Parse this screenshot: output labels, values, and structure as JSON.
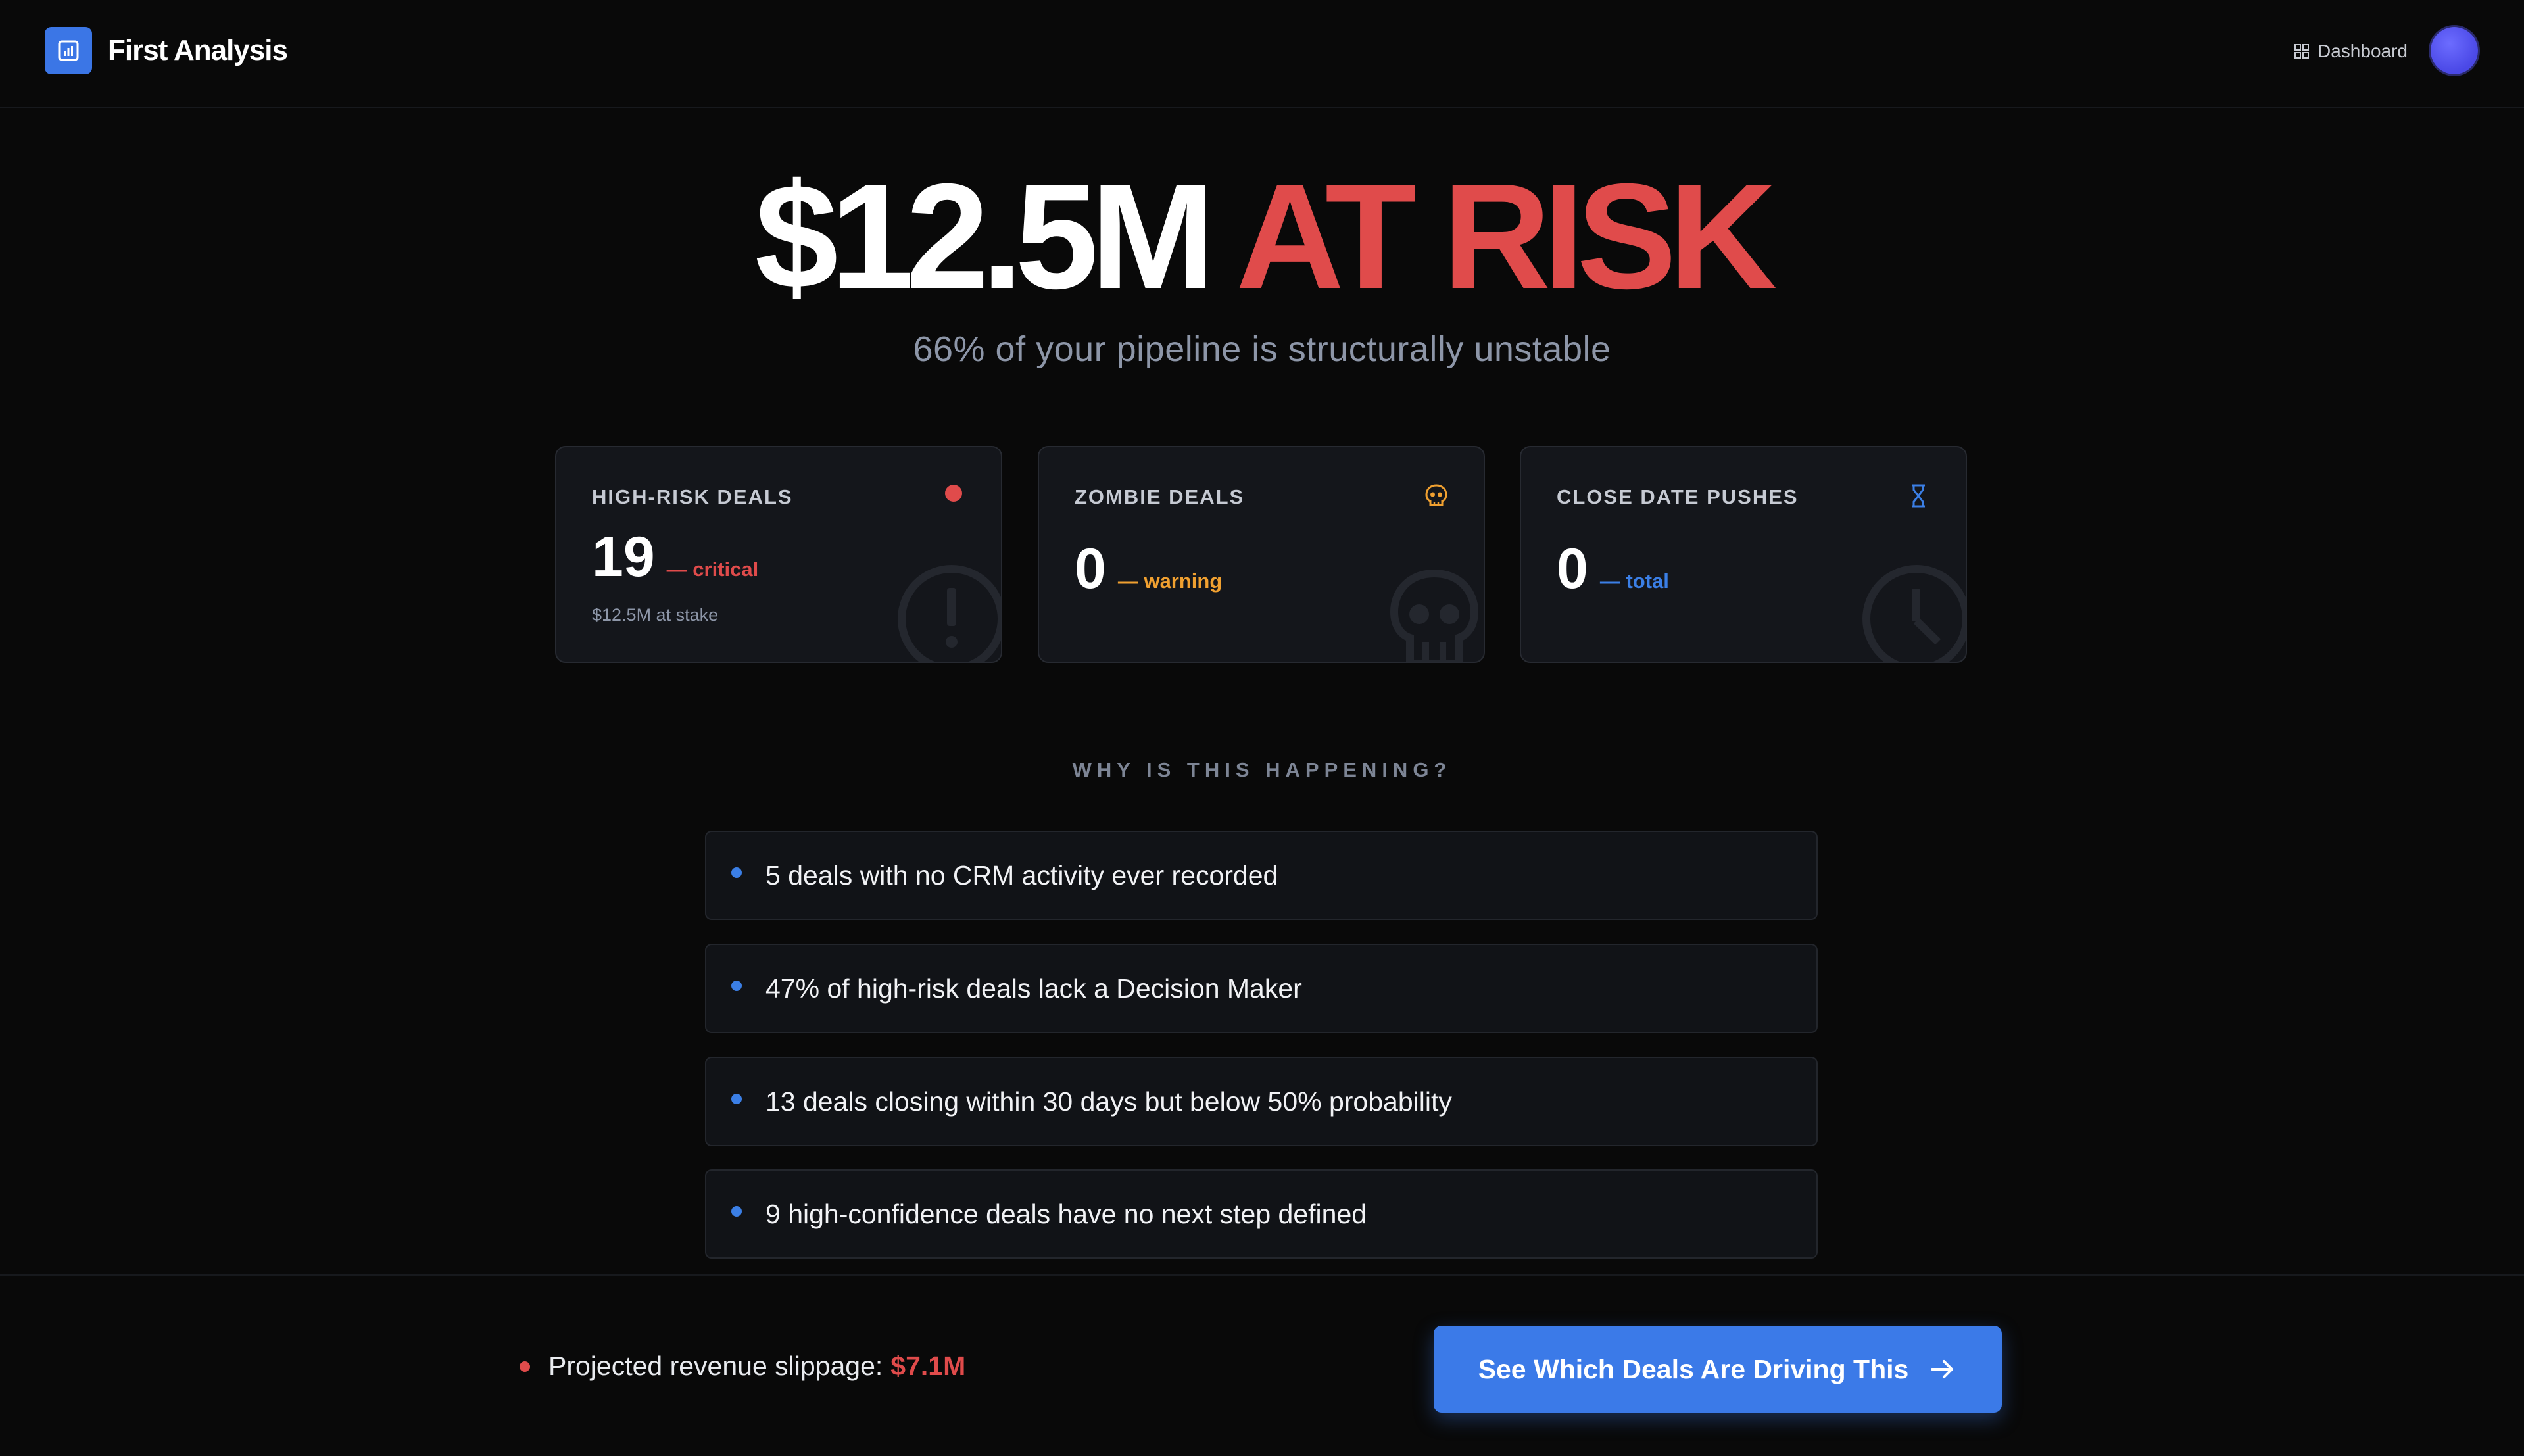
{
  "header": {
    "app_title": "First Analysis",
    "nav_dashboard_label": "Dashboard"
  },
  "hero": {
    "amount": "$12.5M",
    "risk_label": "AT RISK",
    "subtitle": "66% of your pipeline is structurally unstable"
  },
  "cards": [
    {
      "title": "HIGH-RISK DEALS",
      "value": "19",
      "tag": "— critical",
      "sub": "$12.5M at stake",
      "icon": "red-dot-icon",
      "bg_icon": "alert-circle-icon"
    },
    {
      "title": "ZOMBIE DEALS",
      "value": "0",
      "tag": "— warning",
      "icon": "skull-icon",
      "bg_icon": "skull-icon"
    },
    {
      "title": "CLOSE DATE PUSHES",
      "value": "0",
      "tag": "— total",
      "icon": "hourglass-icon",
      "bg_icon": "clock-icon"
    }
  ],
  "why": {
    "heading": "WHY IS THIS HAPPENING?",
    "reasons": [
      "5 deals with no CRM activity ever recorded",
      "47% of high-risk deals lack a Decision Maker",
      "13 deals closing within 30 days but below 50% probability",
      "9 high-confidence deals have no next step defined"
    ]
  },
  "footer": {
    "slippage_label": "Projected revenue slippage:",
    "slippage_amount": "$7.1M",
    "cta_label": "See Which Deals Are Driving This"
  },
  "colors": {
    "background": "#090909",
    "accent_blue": "#3b7ae8",
    "risk_red": "#e04b4b",
    "warning_orange": "#f0a030",
    "card_bg": "#14161b"
  }
}
